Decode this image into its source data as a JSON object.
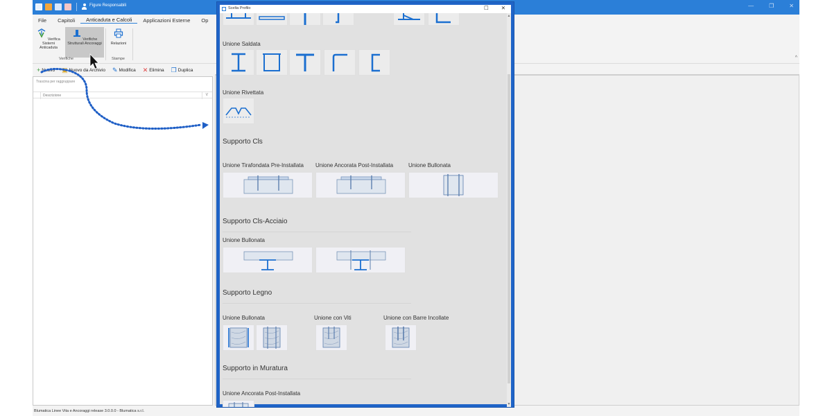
{
  "app": {
    "title": "Figure Responsabili",
    "window_buttons": [
      "—",
      "❐",
      "✕"
    ],
    "menu": [
      "File",
      "Capitoli",
      "Anticaduta e Calcoli",
      "Applicazioni Esterne",
      "Op"
    ],
    "ribbon": {
      "btn_verifica_sistemi": "Verifica Sistemi Anticaduta",
      "btn_verifiche_strutturali": "Verifiche Strutturali Ancoraggi",
      "btn_relazioni": "Relazioni",
      "group_verifiche": "Verifiche",
      "group_stampe": "Stampe",
      "collapse": "^"
    },
    "toolbar": {
      "nuovo": "Nuovo",
      "nuovo_archivio": "Nuovo da Archivio",
      "modifica": "Modifica",
      "elimina": "Elimina",
      "duplica": "Duplica"
    },
    "grid": {
      "group_hint": "Trascina per raggruppare",
      "col_descrizione": "Descrizione",
      "filter_icon": "V"
    },
    "status": "Blumatica Linee Vita e Ancoraggi release 3.0.0.0 - Blumatica s.r.l."
  },
  "dialog": {
    "title": "Scelta Profilo",
    "buttons": [
      "☐",
      "✕"
    ],
    "sections": {
      "unione_saldata": "Unione Saldata",
      "unione_rivettata": "Unione Rivettata",
      "supporto_cls": "Supporto Cls",
      "cls_tirafondata": "Unione Tirafondata Pre-Installata",
      "cls_ancorata": "Unione Ancorata Post-Installata",
      "cls_bullonata": "Unione Bullonata",
      "supporto_cls_acciaio": "Supporto Cls-Acciaio",
      "clsacc_bullonata": "Unione Bullonata",
      "supporto_legno": "Supporto Legno",
      "legno_bullonata": "Unione Bullonata",
      "legno_viti": "Unione con Viti",
      "legno_barre": "Unione con Barre Incollate",
      "supporto_muratura": "Supporto in Muratura",
      "mur_ancorata": "Unione Ancorata Post-Installata"
    }
  },
  "colors": {
    "accent": "#2b7fd8",
    "dialog_border": "#1f64c8",
    "profile_blue": "#1b6fd0",
    "arrow_blue": "#1f5fc6"
  }
}
